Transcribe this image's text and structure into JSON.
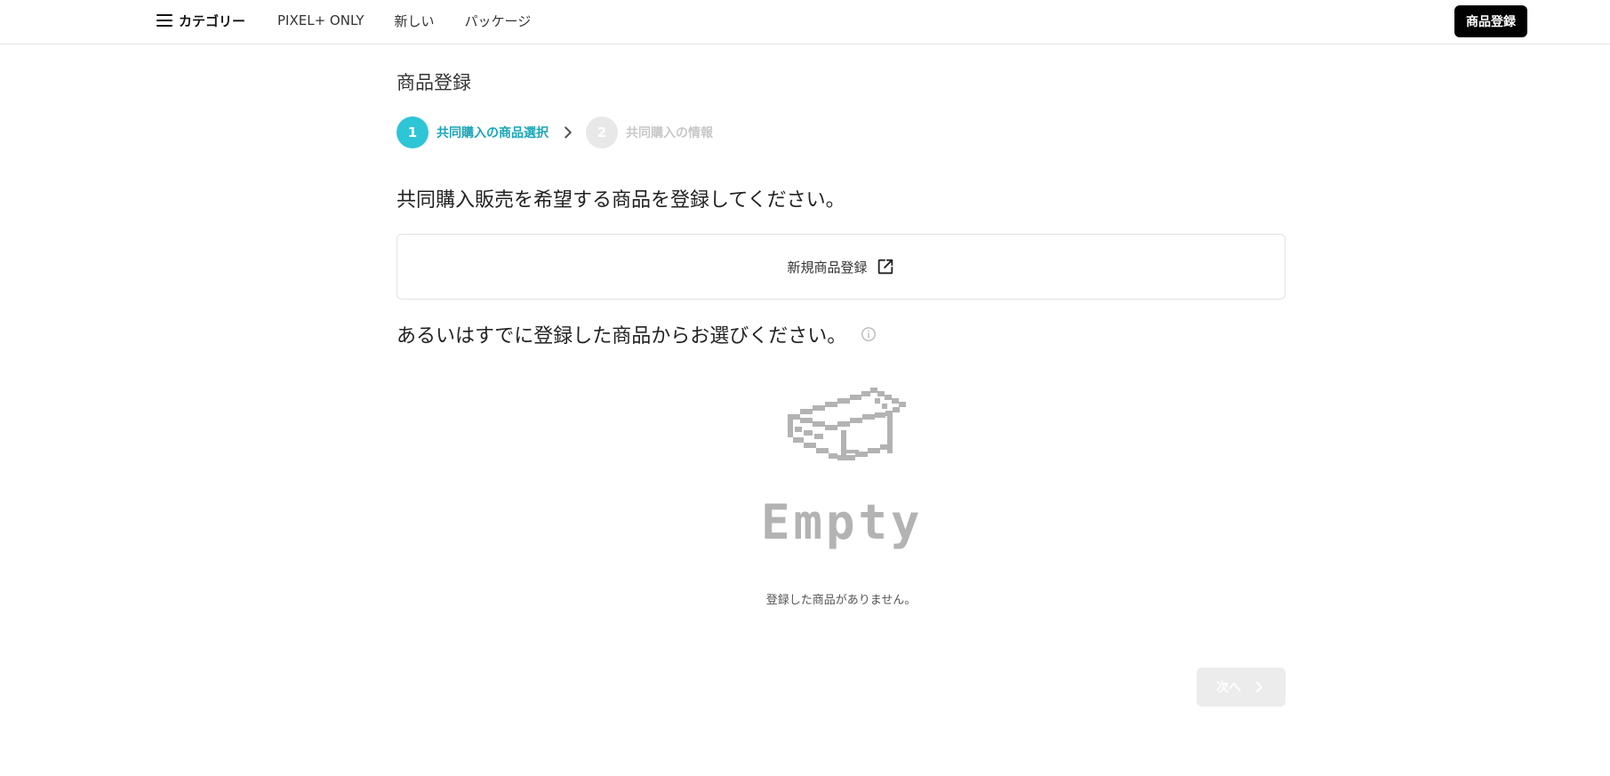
{
  "header": {
    "category_label": "カテゴリー",
    "nav_items": [
      "PIXEL+ ONLY",
      "新しい",
      "パッケージ"
    ],
    "register_button": "商品登録"
  },
  "page": {
    "title": "商品登録"
  },
  "stepper": {
    "steps": [
      {
        "number": "1",
        "label": "共同購入の商品選択",
        "active": true
      },
      {
        "number": "2",
        "label": "共同購入の情報",
        "active": false
      }
    ]
  },
  "section1": {
    "question": "共同購入販売を希望する商品を登録してください。",
    "new_product_label": "新規商品登録"
  },
  "section2": {
    "question": "あるいはすでに登録した商品からお選びください。",
    "empty_word": "Empty",
    "empty_message": "登録した商品がありません。"
  },
  "footer": {
    "next_label": "次へ"
  },
  "colors": {
    "accent": "#2ec5d6",
    "accent_text": "#1aa6b6",
    "primary_button": "#000000",
    "disabled_button": "#ececec",
    "empty_gray": "#b3b3b3"
  },
  "icons": {
    "menu": "hamburger-icon",
    "chevron": "chevron-right-icon",
    "external": "external-link-icon",
    "info": "info-circle-icon",
    "empty": "pixel-box-icon"
  }
}
